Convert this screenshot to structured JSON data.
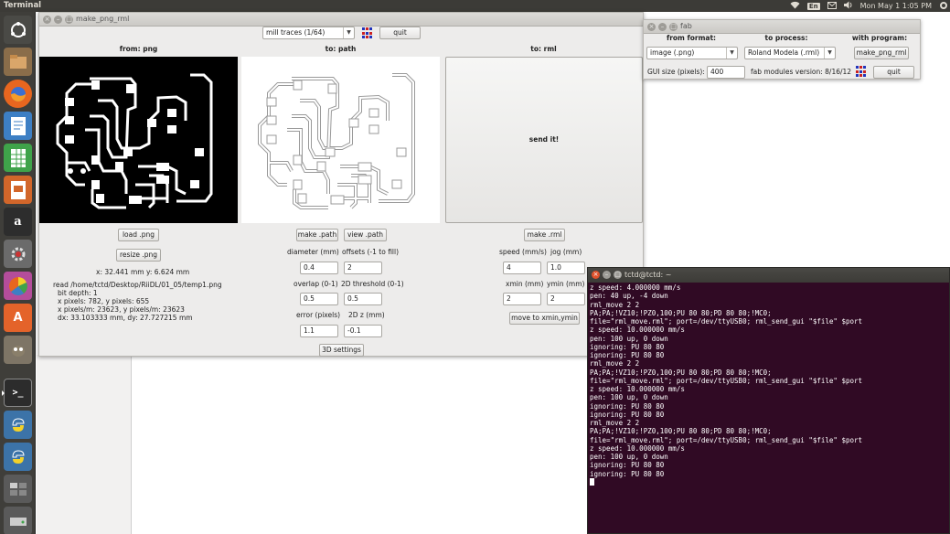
{
  "topbar": {
    "app": "Terminal",
    "lang": "En",
    "clock": "Mon May  1  1:05 PM"
  },
  "launcher": {
    "items": [
      {
        "name": "ubuntu-dash",
        "color": "#4a4a46"
      },
      {
        "name": "files",
        "color": "#8a6d4a"
      },
      {
        "name": "firefox",
        "color": "#e8661f"
      },
      {
        "name": "libreoffice-writer",
        "color": "#3d7fc4"
      },
      {
        "name": "libreoffice-calc",
        "color": "#3fa34a"
      },
      {
        "name": "libreoffice-impress",
        "color": "#d2662a"
      },
      {
        "name": "amazon",
        "color": "#2d2d2d"
      },
      {
        "name": "system-settings",
        "color": "#6b6b6b"
      },
      {
        "name": "color-app",
        "color": "#b44d9b"
      },
      {
        "name": "software-center",
        "color": "#e4632a"
      },
      {
        "name": "gimp",
        "color": "#7e7566"
      },
      {
        "name": "terminal",
        "color": "#2c2c2c"
      },
      {
        "name": "python",
        "color": "#3c73a8"
      },
      {
        "name": "python-2",
        "color": "#3c73a8"
      },
      {
        "name": "workspaces",
        "color": "#5a5a5a"
      },
      {
        "name": "drive",
        "color": "#5a5a5a"
      }
    ]
  },
  "mpr": {
    "title": "make_png_rml",
    "mode": "mill traces (1/64)",
    "quit": "quit",
    "from_png": "from: png",
    "to_path": "to: path",
    "to_rml": "to: rml",
    "send_it": "send it!",
    "load_png": "load .png",
    "resize_png": "resize .png",
    "make_path": "make .path",
    "view_path": "view .path",
    "make_rml": "make .rml",
    "coords": "x: 32.441 mm  y: 6.624 mm",
    "info": [
      "read /home/tctd/Desktop/RiiDL/01_05/temp1.png",
      "bit depth: 1",
      "x pixels: 782, y pixels: 655",
      "x pixels/m: 23623, y pixels/m: 23623",
      "dx: 33.103333 mm, dy: 27.727215 mm"
    ],
    "diameter_label": "diameter (mm)",
    "diameter": "0.4",
    "offsets_label": "offsets (-1 to fill)",
    "offsets": "2",
    "overlap_label": "overlap (0-1)",
    "overlap": "0.5",
    "threshold_label": "2D threshold (0-1)",
    "threshold": "0.5",
    "error_label": "error (pixels)",
    "error": "1.1",
    "z_label": "2D z (mm)",
    "z": "-0.1",
    "settings_3d": "3D settings",
    "speed_label": "speed (mm/s)",
    "speed": "4",
    "jog_label": "jog (mm)",
    "jog": "1.0",
    "xmin_label": "xmin (mm)",
    "xmin": "2",
    "ymin_label": "ymin (mm)",
    "ymin": "2",
    "move_to": "move to xmin,ymin"
  },
  "fab": {
    "title": "fab",
    "from_format": "from format:",
    "to_process": "to process:",
    "with_program": "with program:",
    "format": "image (.png)",
    "process": "Roland Modela (.rml)",
    "program": "make_png_rml",
    "gui_size_label": "GUI size (pixels):",
    "gui_size": "400",
    "version": "fab modules version: 8/16/12",
    "quit": "quit"
  },
  "terminal": {
    "title": "tctd@tctd: ~",
    "lines": [
      "z speed: 4.000000 mm/s",
      "pen: 40 up, -4 down",
      "rml_move 2 2",
      "PA;PA;!VZ10;!PZ0,100;PU 80 80;PD 80 80;!MC0;",
      "file=\"rml_move.rml\"; port=/dev/ttyUSB0; rml_send_gui \"$file\" $port",
      "z speed: 10.000000 mm/s",
      "pen: 100 up, 0 down",
      "ignoring: PU 80 80",
      "ignoring: PU 80 80",
      "rml_move 2 2",
      "PA;PA;!VZ10;!PZ0,100;PU 80 80;PD 80 80;!MC0;",
      "file=\"rml_move.rml\"; port=/dev/ttyUSB0; rml_send_gui \"$file\" $port",
      "z speed: 10.000000 mm/s",
      "pen: 100 up, 0 down",
      "ignoring: PU 80 80",
      "ignoring: PU 80 80",
      "rml_move 2 2",
      "PA;PA;!VZ10;!PZ0,100;PU 80 80;PD 80 80;!MC0;",
      "file=\"rml_move.rml\"; port=/dev/ttyUSB0; rml_send_gui \"$file\" $port",
      "z speed: 10.000000 mm/s",
      "pen: 100 up, 0 down",
      "ignoring: PU 80 80",
      "ignoring: PU 80 80"
    ]
  }
}
